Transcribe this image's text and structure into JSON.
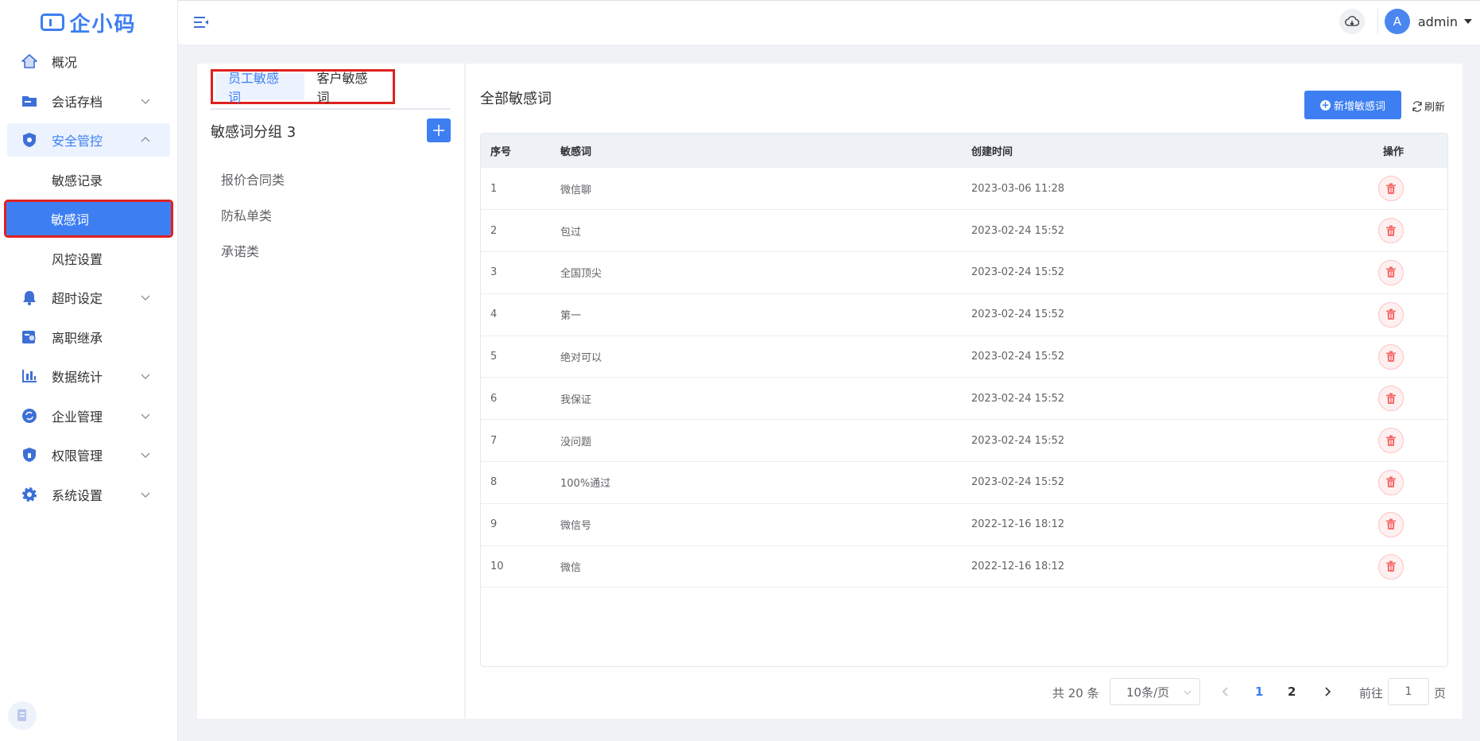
{
  "app": {
    "logo_text": "企小码"
  },
  "sidebar": {
    "items": [
      {
        "label": "概况",
        "icon": "home-icon"
      },
      {
        "label": "会话存档",
        "icon": "folder-icon",
        "expandable": true
      },
      {
        "label": "安全管控",
        "icon": "shield-icon",
        "expandable": true,
        "open": true
      },
      {
        "label": "超时设定",
        "icon": "bell-icon",
        "expandable": true
      },
      {
        "label": "离职继承",
        "icon": "user-card-icon"
      },
      {
        "label": "数据统计",
        "icon": "bar-chart-icon",
        "expandable": true
      },
      {
        "label": "企业管理",
        "icon": "refresh-circle-icon",
        "expandable": true
      },
      {
        "label": "权限管理",
        "icon": "lock-shield-icon",
        "expandable": true
      },
      {
        "label": "系统设置",
        "icon": "gear-icon",
        "expandable": true
      }
    ],
    "submenu": [
      {
        "label": "敏感记录"
      },
      {
        "label": "敏感词",
        "active": true
      },
      {
        "label": "风控设置"
      }
    ]
  },
  "header": {
    "user_initial": "A",
    "user_name": "admin"
  },
  "groups_panel": {
    "tabs": [
      {
        "label": "员工敏感词",
        "active": true
      },
      {
        "label": "客户敏感词",
        "active": false
      }
    ],
    "title": "敏感词分组 3",
    "groups": [
      "报价合同类",
      "防私单类",
      "承诺类"
    ]
  },
  "main": {
    "title": "全部敏感词",
    "add_button": "新增敏感词",
    "refresh_button": "刷新",
    "columns": [
      "序号",
      "敏感词",
      "创建时间",
      "操作"
    ],
    "rows": [
      {
        "index": "1",
        "word": "微信聊",
        "created": "2023-03-06 11:28"
      },
      {
        "index": "2",
        "word": "包过",
        "created": "2023-02-24 15:52"
      },
      {
        "index": "3",
        "word": "全国顶尖",
        "created": "2023-02-24 15:52"
      },
      {
        "index": "4",
        "word": "第一",
        "created": "2023-02-24 15:52"
      },
      {
        "index": "5",
        "word": "绝对可以",
        "created": "2023-02-24 15:52"
      },
      {
        "index": "6",
        "word": "我保证",
        "created": "2023-02-24 15:52"
      },
      {
        "index": "7",
        "word": "没问题",
        "created": "2023-02-24 15:52"
      },
      {
        "index": "8",
        "word": "100%通过",
        "created": "2023-02-24 15:52"
      },
      {
        "index": "9",
        "word": "微信号",
        "created": "2022-12-16 18:12"
      },
      {
        "index": "10",
        "word": "微信",
        "created": "2022-12-16 18:12"
      }
    ],
    "pagination": {
      "total_text": "共 20 条",
      "page_size": "10条/页",
      "pages": [
        "1",
        "2"
      ],
      "current_page": "1",
      "goto_label": "前往",
      "goto_value": "1",
      "page_suffix": "页"
    }
  },
  "colors": {
    "primary": "#3d7ff2",
    "danger": "#f56c6c",
    "highlight_box": "#e02020"
  }
}
